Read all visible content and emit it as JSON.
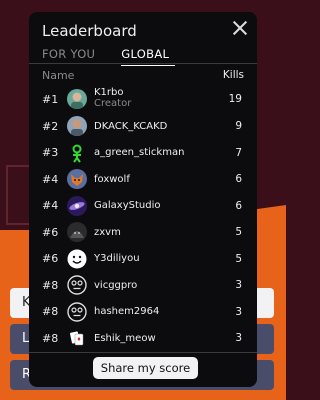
{
  "background": {
    "buttons": [
      {
        "label": "K"
      },
      {
        "label": "L"
      },
      {
        "label": "R"
      }
    ]
  },
  "leaderboard": {
    "title": "Leaderboard",
    "tabs": [
      {
        "label": "FOR YOU"
      },
      {
        "label": "GLOBAL"
      }
    ],
    "active_tab": "GLOBAL",
    "columns": {
      "name": "Name",
      "kills": "Kills"
    },
    "rows": [
      {
        "rank": "#1",
        "name": "K1rbo",
        "subtitle": "Creator",
        "kills": "19",
        "avatar": "green-portrait-avatar"
      },
      {
        "rank": "#2",
        "name": "DKACK_KCAKD",
        "kills": "9",
        "avatar": "boy-portrait-avatar"
      },
      {
        "rank": "#3",
        "name": "a_green_stickman",
        "kills": "7",
        "avatar": "green-stickman-avatar"
      },
      {
        "rank": "#4",
        "name": "foxwolf",
        "kills": "6",
        "avatar": "fox-avatar"
      },
      {
        "rank": "#4",
        "name": "GalaxyStudio",
        "kills": "6",
        "avatar": "galaxy-avatar"
      },
      {
        "rank": "#6",
        "name": "zxvm",
        "kills": "5",
        "avatar": "dark-creature-avatar"
      },
      {
        "rank": "#6",
        "name": "Y3diliyou",
        "kills": "5",
        "avatar": "smiley-avatar"
      },
      {
        "rank": "#8",
        "name": "vicggpro",
        "kills": "3",
        "avatar": "default-face-avatar"
      },
      {
        "rank": "#8",
        "name": "hashem2964",
        "kills": "3",
        "avatar": "default-face-avatar"
      },
      {
        "rank": "#8",
        "name": "Eshik_meow",
        "kills": "3",
        "avatar": "cards-avatar"
      }
    ],
    "share_label": "Share my score"
  }
}
